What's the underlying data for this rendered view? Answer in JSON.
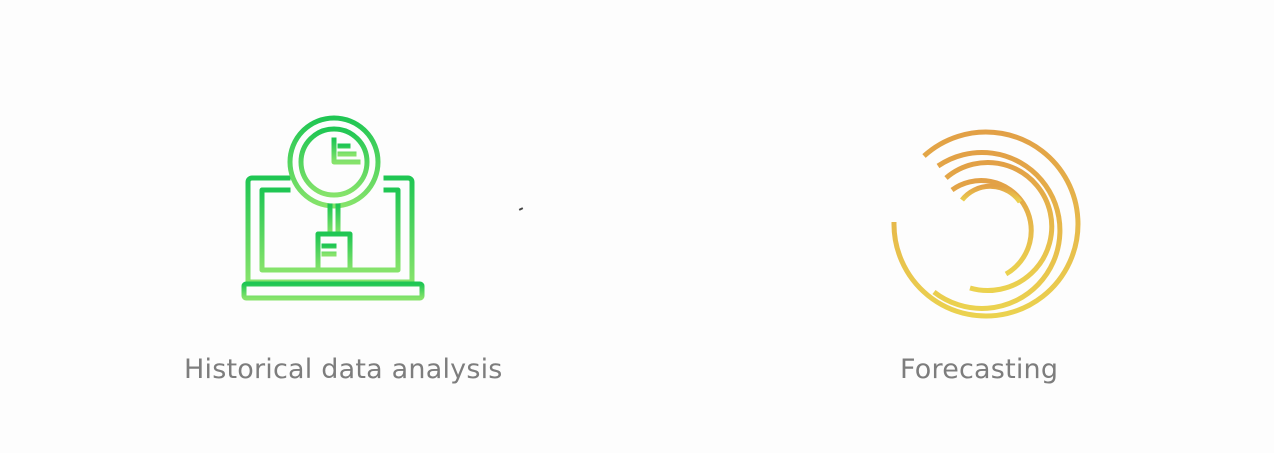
{
  "features": [
    {
      "icon": "laptop-magnifier-clock-icon",
      "color_top": "#22c85a",
      "color_bottom": "#7fe06a",
      "label": "Historical data analysis"
    },
    {
      "icon": "concentric-arcs-forecast-icon",
      "color_top": "#e0a24a",
      "color_bottom": "#e8cf4e",
      "label": "Forecasting"
    }
  ]
}
